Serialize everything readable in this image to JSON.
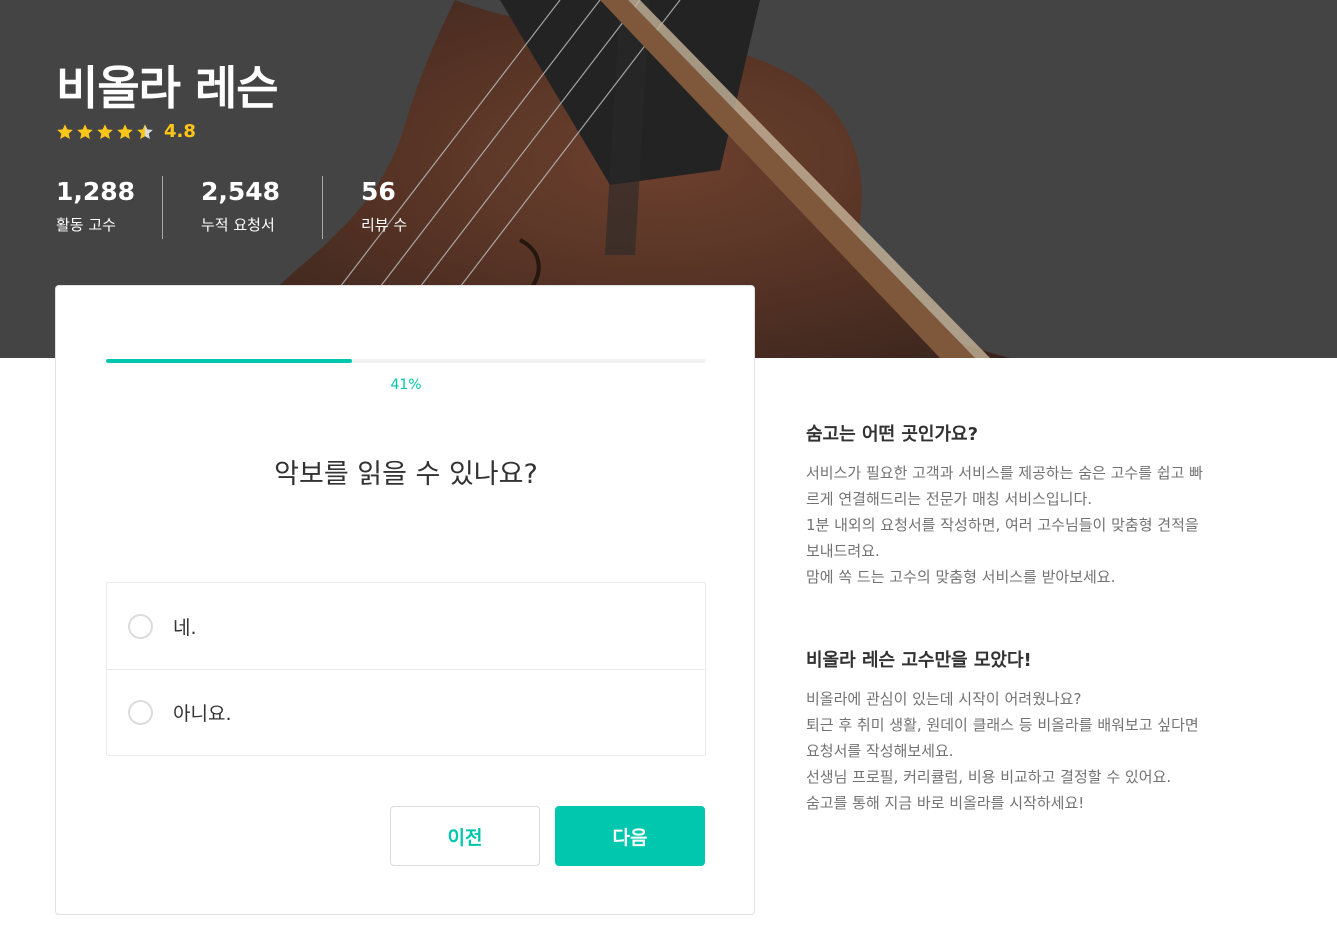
{
  "hero": {
    "title": "비올라 레슨",
    "rating": {
      "value": "4.8",
      "stars": 4.5
    },
    "stats": [
      {
        "value": "1,288",
        "label": "활동 고수"
      },
      {
        "value": "2,548",
        "label": "누적 요청서"
      },
      {
        "value": "56",
        "label": "리뷰 수"
      }
    ]
  },
  "survey": {
    "progress": {
      "fraction": 0.41,
      "label": "41%"
    },
    "question": "악보를 읽을 수 있나요?",
    "options": [
      {
        "label": "네."
      },
      {
        "label": "아니요."
      }
    ],
    "buttons": {
      "prev": "이전",
      "next": "다음"
    }
  },
  "info": {
    "sections": [
      {
        "heading": "숨고는 어떤 곳인가요?",
        "lines": [
          "서비스가 필요한 고객과 서비스를 제공하는 숨은 고수를 쉽고 빠",
          "르게 연결해드리는 전문가 매칭 서비스입니다.",
          "1분 내외의 요청서를 작성하면, 여러 고수님들이 맞춤형 견적을",
          "보내드려요.",
          "맘에 쏙 드는 고수의 맞춤형 서비스를 받아보세요."
        ]
      },
      {
        "heading": "비올라 레슨 고수만을 모았다!",
        "lines": [
          "비올라에 관심이 있는데 시작이 어려웠나요?",
          "퇴근 후 취미 생활, 원데이 클래스 등 비올라를 배워보고 싶다면",
          "요청서를 작성해보세요.",
          "선생님 프로필, 커리큘럼, 비용 비교하고 결정할 수 있어요.",
          "숨고를 통해 지금 바로 비올라를 시작하세요!"
        ]
      }
    ]
  },
  "colors": {
    "accent": "#00c7ae",
    "star": "#ffc61a",
    "hero_overlay": "#4a4a4a"
  },
  "icons": [
    "star-icon",
    "radio-icon"
  ]
}
